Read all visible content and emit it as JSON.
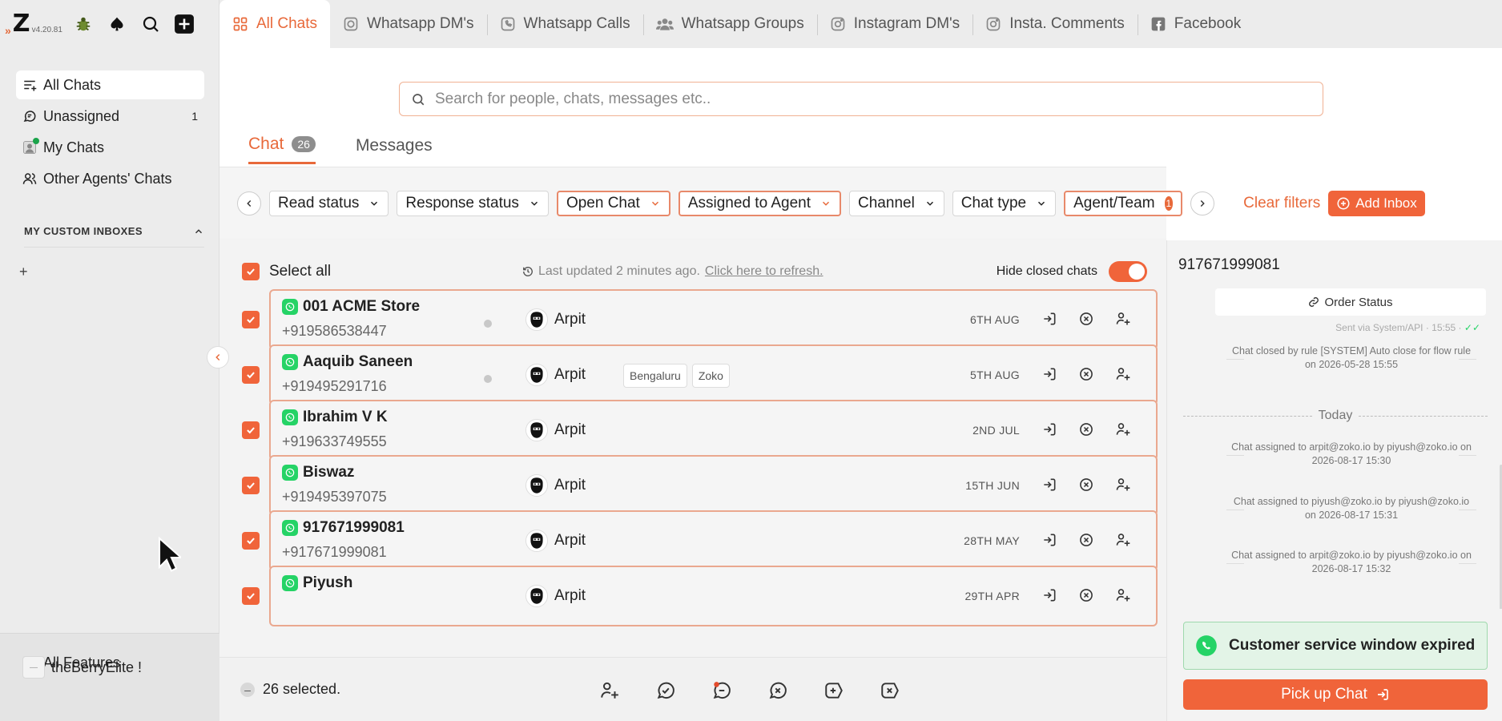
{
  "app": {
    "version": "v4.20.81"
  },
  "sidebar": {
    "nav": [
      {
        "label": "All Chats",
        "count": ""
      },
      {
        "label": "Unassigned",
        "count": "1"
      },
      {
        "label": "My Chats",
        "count": ""
      },
      {
        "label": "Other Agents' Chats",
        "count": ""
      }
    ],
    "section_title": "MY CUSTOM INBOXES",
    "add_label": "+",
    "all_features": "All Features",
    "user": "theBerryElite !"
  },
  "tabs": [
    {
      "label": "All Chats",
      "icon": "grid-icon"
    },
    {
      "label": "Whatsapp DM's",
      "icon": "whatsapp-icon"
    },
    {
      "label": "Whatsapp Calls",
      "icon": "phone-icon"
    },
    {
      "label": "Whatsapp Groups",
      "icon": "group-icon"
    },
    {
      "label": "Instagram DM's",
      "icon": "instagram-icon"
    },
    {
      "label": "Insta. Comments",
      "icon": "instagram-icon"
    },
    {
      "label": "Facebook",
      "icon": "facebook-icon"
    }
  ],
  "search": {
    "placeholder": "Search for people, chats, messages etc.."
  },
  "subtabs": {
    "chat": "Chat",
    "chat_count": "26",
    "messages": "Messages"
  },
  "filters": {
    "read_status": "Read status",
    "response_status": "Response status",
    "open_chat": "Open Chat",
    "assigned": "Assigned to Agent",
    "channel": "Channel",
    "chat_type": "Chat type",
    "agent_team": "Agent/Team",
    "agent_team_count": "1",
    "clear": "Clear filters",
    "add_inbox": "Add Inbox"
  },
  "list": {
    "select_all": "Select all",
    "updated": "Last updated 2 minutes ago.",
    "refresh": "Click here to refresh.",
    "hide_closed": "Hide closed chats",
    "rows": [
      {
        "name": "001 ACME Store",
        "phone": "+919586538447",
        "agent": "Arpit",
        "date": "6TH AUG",
        "dot": true,
        "tags": []
      },
      {
        "name": "Aaquib Saneen",
        "phone": "+919495291716",
        "agent": "Arpit",
        "date": "5TH AUG",
        "dot": true,
        "tags": [
          "Bengaluru",
          "Zoko"
        ]
      },
      {
        "name": "Ibrahim V K",
        "phone": "+919633749555",
        "agent": "Arpit",
        "date": "2ND JUL",
        "dot": false,
        "tags": []
      },
      {
        "name": "Biswaz",
        "phone": "+919495397075",
        "agent": "Arpit",
        "date": "15TH JUN",
        "dot": false,
        "tags": []
      },
      {
        "name": "917671999081",
        "phone": "+917671999081",
        "agent": "Arpit",
        "date": "28TH MAY",
        "dot": false,
        "tags": []
      },
      {
        "name": "Piyush",
        "phone": "",
        "agent": "Arpit",
        "date": "29TH APR",
        "dot": false,
        "tags": []
      }
    ],
    "selected": "26 selected."
  },
  "right_panel": {
    "title": "917671999081",
    "order_status": "Order Status",
    "sent_via": "Sent via System/API · 15:55 ·",
    "closed_msg": "Chat closed by rule [SYSTEM] Auto close for flow rule on 2026-05-28 15:55",
    "today": "Today",
    "events": [
      "Chat assigned to arpit@zoko.io by piyush@zoko.io on 2026-08-17 15:30",
      "Chat assigned to piyush@zoko.io by piyush@zoko.io on 2026-08-17 15:31",
      "Chat assigned to arpit@zoko.io by piyush@zoko.io on 2026-08-17 15:32"
    ],
    "window_expired": "Customer service window expired",
    "pickup": "Pick up Chat"
  },
  "colors": {
    "accent": "#f0643a",
    "whatsapp": "#25d366"
  }
}
